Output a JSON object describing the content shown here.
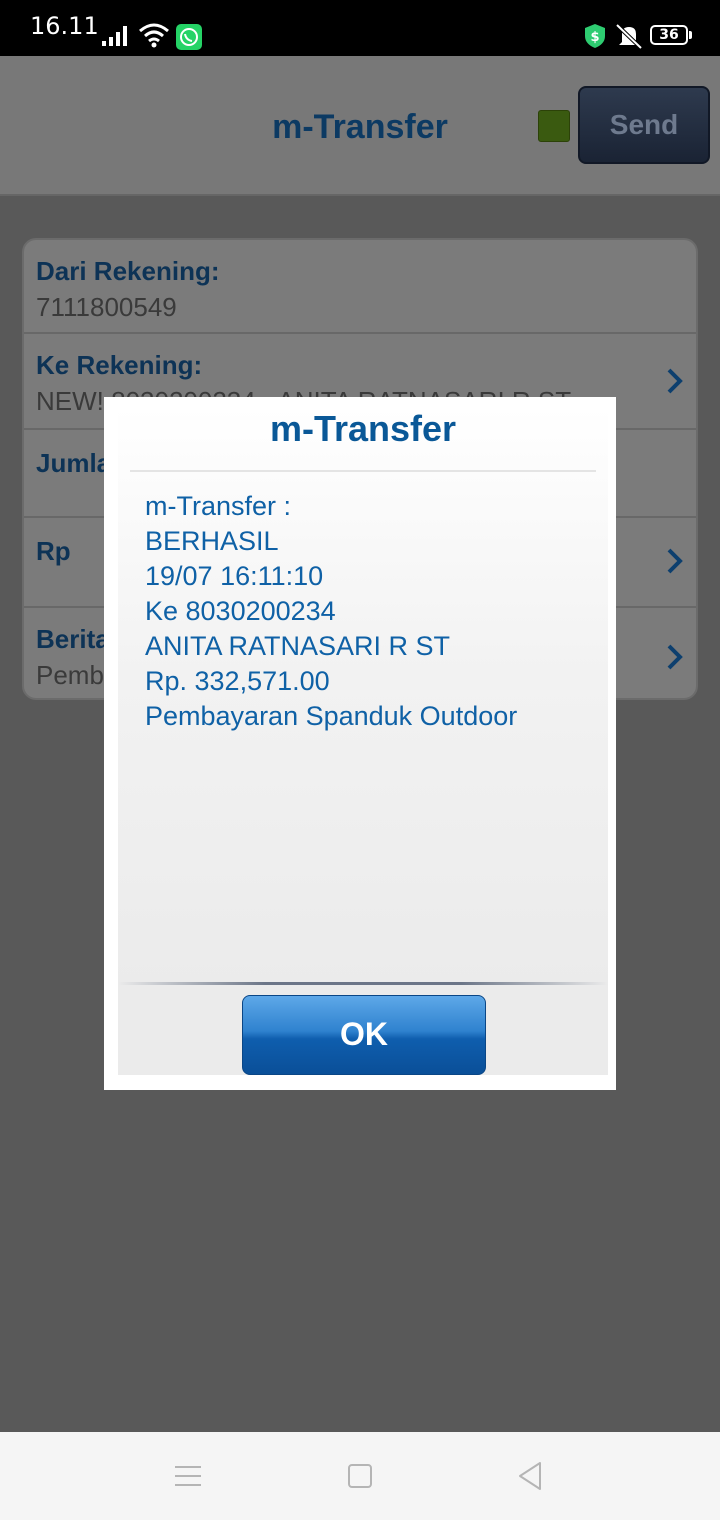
{
  "status_bar": {
    "time": "16.11",
    "battery": "36",
    "icons": [
      "signal-icon",
      "wifi-icon",
      "whatsapp-icon",
      "shield-icon",
      "mute-icon",
      "battery-icon"
    ]
  },
  "app_bar": {
    "title": "m-Transfer",
    "send_label": "Send",
    "indicator_color": "#6a9a1e"
  },
  "form": {
    "rows": [
      {
        "label": "Dari Rekening:",
        "value": "7111800549"
      },
      {
        "label": "Ke Rekening:",
        "value": "NEW! 8030200234 - ANITA RATNASARI R ST"
      },
      {
        "label": "Jumlah",
        "value": ""
      },
      {
        "label": "Rp",
        "value": ""
      },
      {
        "label": "Berita",
        "value": "Pembayaran Spanduk Outdoor"
      }
    ]
  },
  "dialog": {
    "title": "m-Transfer",
    "lines": [
      "m-Transfer :",
      "BERHASIL",
      "19/07 16:11:10",
      "Ke 8030200234",
      "ANITA RATNASARI R ST",
      "Rp. 332,571.00",
      "Pembayaran Spanduk Outdoor"
    ],
    "ok_label": "OK"
  },
  "nav_bar": {
    "icons": [
      "menu-icon",
      "home-icon",
      "back-icon"
    ]
  },
  "colors": {
    "accent": "#0f61a6",
    "title_blue": "#0a5897",
    "ok_button": "#1f6fc0"
  }
}
